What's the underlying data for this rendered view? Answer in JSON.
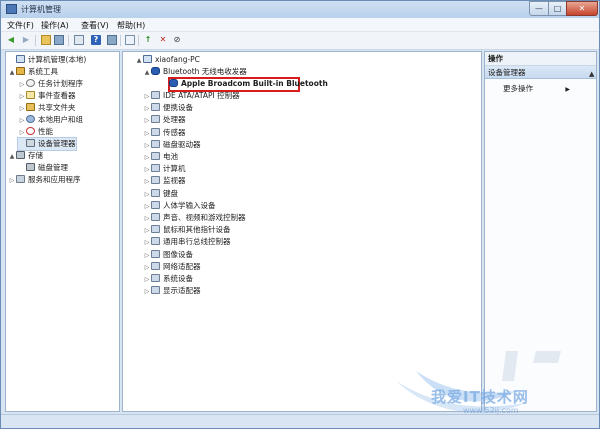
{
  "window": {
    "title": "计算机管理",
    "controls": {
      "minimize": "—",
      "maximize": "□",
      "close": "✕"
    }
  },
  "menu": [
    "文件(F)",
    "操作(A)",
    "查看(V)",
    "帮助(H)"
  ],
  "left_tree": [
    {
      "label": "计算机管理(本地)",
      "icon": "computer-icon",
      "arrow": ""
    },
    {
      "label": "系统工具",
      "icon": "tools-icon",
      "arrow": "▲"
    },
    {
      "label": "任务计划程序",
      "icon": "clock-icon",
      "arrow": "▷"
    },
    {
      "label": "事件查看器",
      "icon": "event-log-icon",
      "arrow": "▷"
    },
    {
      "label": "共享文件夹",
      "icon": "shared-folder-icon",
      "arrow": "▷"
    },
    {
      "label": "本地用户和组",
      "icon": "users-icon",
      "arrow": "▷"
    },
    {
      "label": "性能",
      "icon": "performance-icon",
      "arrow": "▷"
    },
    {
      "label": "设备管理器",
      "icon": "device-manager-icon",
      "arrow": ""
    },
    {
      "label": "存储",
      "icon": "storage-icon",
      "arrow": "▲"
    },
    {
      "label": "磁盘管理",
      "icon": "disk-icon",
      "arrow": ""
    },
    {
      "label": "服务和应用程序",
      "icon": "services-icon",
      "arrow": "▷"
    }
  ],
  "device_tree": {
    "root": "xiaofang-PC",
    "bluetooth_group": "Bluetooth 无线电收发器",
    "bluetooth_device": "Apple Broadcom Built-in Bluetooth",
    "categories": [
      "IDE ATA/ATAPI 控制器",
      "便携设备",
      "处理器",
      "传感器",
      "磁盘驱动器",
      "电池",
      "计算机",
      "监视器",
      "键盘",
      "人体学输入设备",
      "声音、视频和游戏控制器",
      "鼠标和其他指针设备",
      "通用串行总线控制器",
      "图像设备",
      "网络适配器",
      "系统设备",
      "显示适配器"
    ]
  },
  "actions": {
    "header": "操作",
    "section": "设备管理器",
    "item": "更多操作",
    "more_arrow": "▶"
  },
  "watermark": {
    "text": "我爱IT技术网",
    "url": "www.52ij.com"
  },
  "colors": {
    "highlight": "#d81c1c",
    "title_bar": "#b9d1ec"
  }
}
